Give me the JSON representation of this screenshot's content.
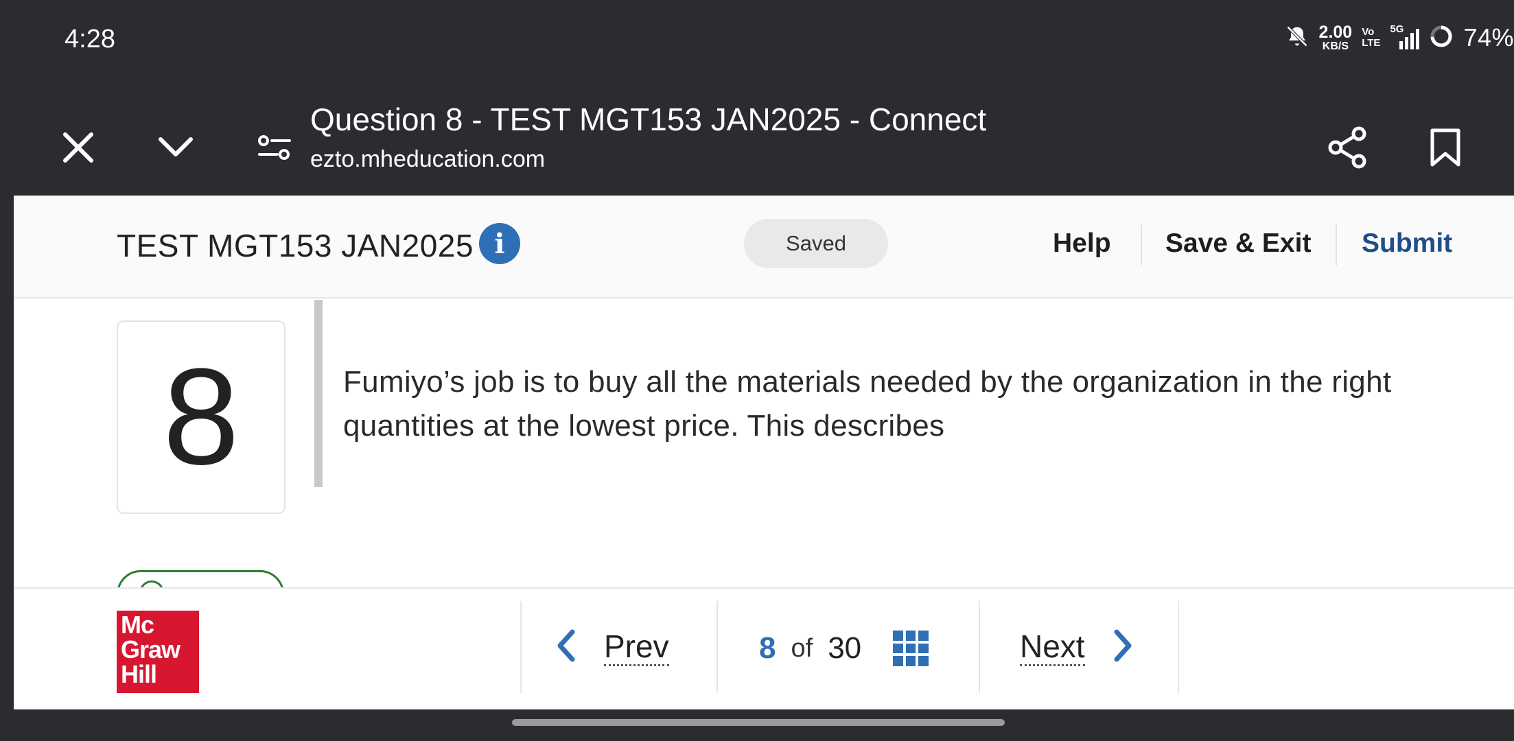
{
  "status_bar": {
    "time": "4:28",
    "net_speed_value": "2.00",
    "net_speed_unit": "KB/S",
    "volte_top": "Vo",
    "volte_bottom": "LTE",
    "network": "5G",
    "battery": "74%",
    "icons": [
      "bell-muted-icon",
      "signal-icon",
      "battery-ring-icon"
    ]
  },
  "browser": {
    "page_title": "Question 8 - TEST MGT153 JAN2025 - Connect",
    "url": "ezto.mheducation.com",
    "icons": [
      "close-icon",
      "chevron-down-icon",
      "site-settings-icon",
      "share-icon",
      "bookmark-icon"
    ]
  },
  "header": {
    "test_title": "TEST MGT153 JAN2025",
    "info_glyph": "i",
    "saved_status": "Saved",
    "help_label": "Help",
    "save_exit_label": "Save & Exit",
    "submit_label": "Submit"
  },
  "question": {
    "number": "8",
    "text": "Fumiyo’s job is to buy all the materials needed by the organization in the right quantities at the lowest price. This describes"
  },
  "footer": {
    "logo_line1": "Mc",
    "logo_line2": "Graw",
    "logo_line3": "Hill",
    "prev_label": "Prev",
    "current_page": "8",
    "of_label": "of",
    "total_pages": "30",
    "next_label": "Next"
  },
  "colors": {
    "brand_blue": "#2f6fb5",
    "submit_blue": "#1f4e8a",
    "logo_red": "#d7172f",
    "chrome_dark": "#2b2c30"
  }
}
